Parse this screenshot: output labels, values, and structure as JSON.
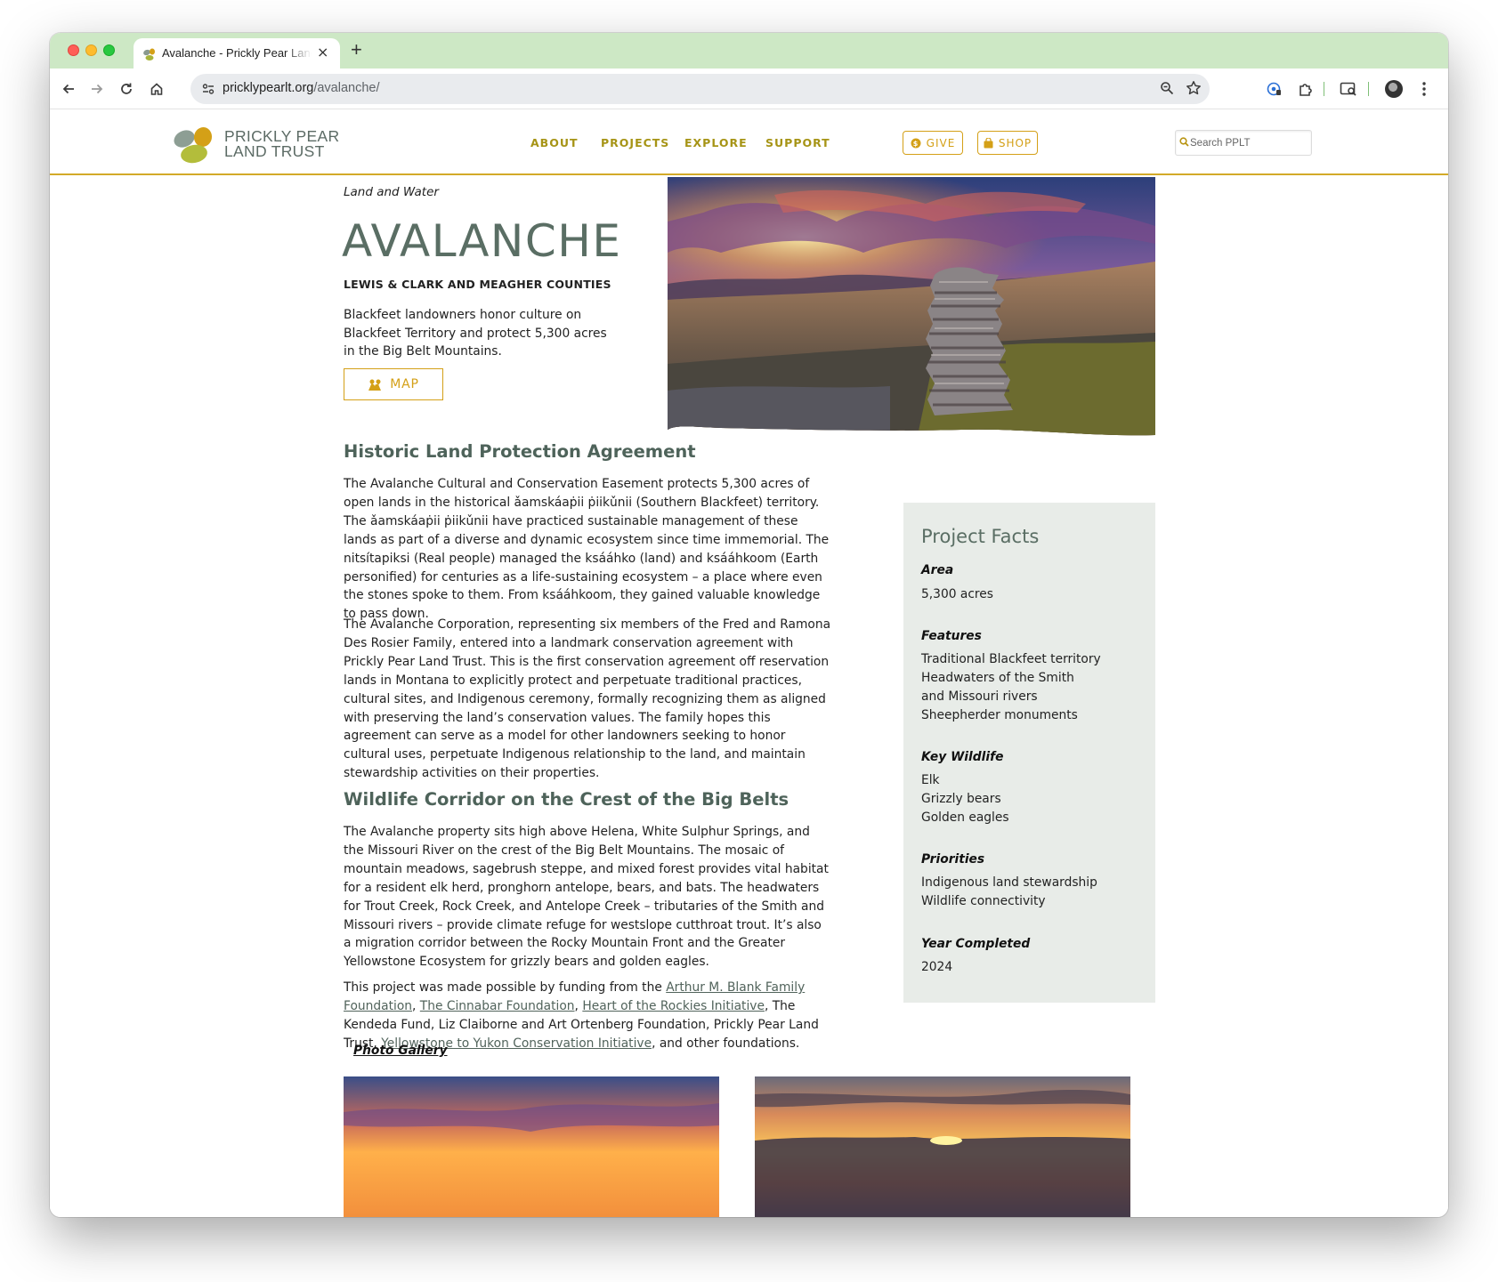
{
  "browser": {
    "tab_title": "Avalanche - Prickly Pear Land Trust",
    "url_domain": "pricklypearlt.org",
    "url_path": "/avalanche/",
    "new_tab": "+",
    "close_tab": "×"
  },
  "site": {
    "logo_line1": "PRICKLY PEAR",
    "logo_line2": "LAND TRUST",
    "nav": [
      "ABOUT",
      "PROJECTS",
      "EXPLORE",
      "SUPPORT"
    ],
    "give_label": "GIVE",
    "shop_label": "SHOP",
    "search_placeholder": "Search PPLT",
    "accent_color": "#d4a017",
    "heading_color": "#4e635a"
  },
  "hero": {
    "kicker": "Land and Water",
    "title": "AVALANCHE",
    "counties": "LEWIS & CLARK AND MEAGHER COUNTIES",
    "description": "Blackfeet landowners honor culture on Blackfeet Territory and protect 5,300 acres in the Big Belt Mountains.",
    "map_label": "MAP"
  },
  "article": {
    "section1_title": "Historic Land Protection Agreement",
    "p1": "The Avalanche Cultural and Conservation Easement protects 5,300 acres of open lands in the historical ǎamskáaṗii ṗiikǔnii (Southern Blackfeet) territory. The ǎamskáaṗii ṗiikǔnii have practiced sustainable management of these lands as part of a diverse and dynamic ecosystem since time immemorial. The nitsítapiksi (Real people) managed the ksááhko (land) and ksááhkoom (Earth personified) for centuries as a life-sustaining ecosystem – a place where even the stones spoke to them. From ksááhkoom, they gained valuable knowledge to pass down.",
    "p2": "The Avalanche Corporation, representing six members of the Fred and Ramona Des Rosier Family, entered into a landmark conservation agreement with Prickly Pear Land Trust. This is the first conservation agreement off reservation lands in Montana to explicitly protect and perpetuate traditional practices, cultural sites, and Indigenous ceremony, formally recognizing them as aligned with preserving the land’s conservation values. The family hopes this agreement can serve as a model for other landowners seeking to honor cultural uses, perpetuate Indigenous relationship to the land, and maintain stewardship activities on their properties.",
    "section2_title": "Wildlife Corridor on the Crest of the Big Belts",
    "p3": "The Avalanche property sits high above Helena, White Sulphur Springs, and the Missouri River on the crest of the Big Belt Mountains. The mosaic of mountain meadows, sagebrush steppe, and mixed forest provides vital habitat for a resident elk herd, pronghorn antelope, bears, and bats. The headwaters for Trout Creek, Rock Creek, and Antelope Creek – tributaries of the Smith and Missouri rivers – provide climate refuge for westslope cutthroat trout. It’s also a migration corridor between the Rocky Mountain Front and the Greater Yellowstone Ecosystem for grizzly bears and golden eagles.",
    "p4_intro": "This project was made possible by funding from the ",
    "link_blank": "Arthur M. Blank Family Foundation",
    "sep1": ", ",
    "link_cinnabar": "The Cinnabar Foundation",
    "sep2": ", ",
    "link_heart": "Heart of the Rockies Initiative",
    "p4_mid": ", The Kendeda Fund, Liz Claiborne and Art Ortenberg Foundation, Prickly Pear Land Trust, ",
    "link_y2y": "Yellowstone to Yukon Conservation Initiative",
    "p4_end": ", and other foundations.",
    "gallery_label": "Photo Gallery"
  },
  "facts": {
    "title": "Project Facts",
    "area_label": "Area",
    "area_value": "5,300 acres",
    "features_label": "Features",
    "features": [
      "Traditional Blackfeet territory",
      "Headwaters of the Smith and Missouri rivers",
      "Sheepherder monuments"
    ],
    "wildlife_label": "Key Wildlife",
    "wildlife": [
      "Elk",
      "Grizzly bears",
      "Golden eagles"
    ],
    "priorities_label": "Priorities",
    "priorities": [
      "Indigenous land stewardship",
      "Wildlife connectivity"
    ],
    "year_label": "Year Completed",
    "year_value": "2024"
  }
}
